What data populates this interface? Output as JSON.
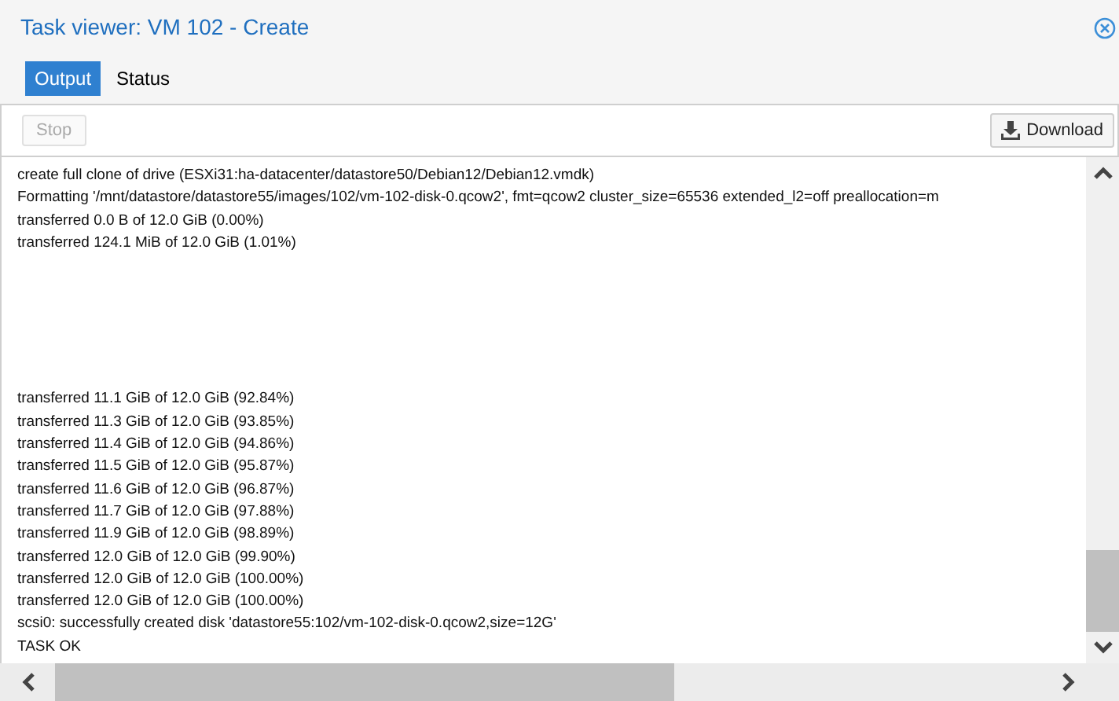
{
  "window": {
    "title": "Task viewer: VM 102 - Create"
  },
  "tabs": [
    {
      "label": "Output",
      "selected": true
    },
    {
      "label": "Status",
      "selected": false
    }
  ],
  "toolbar": {
    "stop": {
      "label": "Stop",
      "disabled": true
    },
    "download": {
      "label": "Download"
    }
  },
  "log": {
    "blocks": [
      [
        "create full clone of drive (ESXi31:ha-datacenter/datastore50/Debian12/Debian12.vmdk)",
        "Formatting '/mnt/datastore/datastore55/images/102/vm-102-disk-0.qcow2', fmt=qcow2 cluster_size=65536 extended_l2=off preallocation=m",
        "transferred 0.0 B of 12.0 GiB (0.00%)",
        "transferred 124.1 MiB of 12.0 GiB (1.01%)"
      ],
      [
        "transferred 11.1 GiB of 12.0 GiB (92.84%)",
        "transferred 11.3 GiB of 12.0 GiB (93.85%)",
        "transferred 11.4 GiB of 12.0 GiB (94.86%)",
        "transferred 11.5 GiB of 12.0 GiB (95.87%)",
        "transferred 11.6 GiB of 12.0 GiB (96.87%)",
        "transferred 11.7 GiB of 12.0 GiB (97.88%)",
        "transferred 11.9 GiB of 12.0 GiB (98.89%)",
        "transferred 12.0 GiB of 12.0 GiB (99.90%)",
        "transferred 12.0 GiB of 12.0 GiB (100.00%)",
        "transferred 12.0 GiB of 12.0 GiB (100.00%)",
        "scsi0: successfully created disk 'datastore55:102/vm-102-disk-0.qcow2,size=12G'",
        "TASK OK"
      ]
    ]
  }
}
